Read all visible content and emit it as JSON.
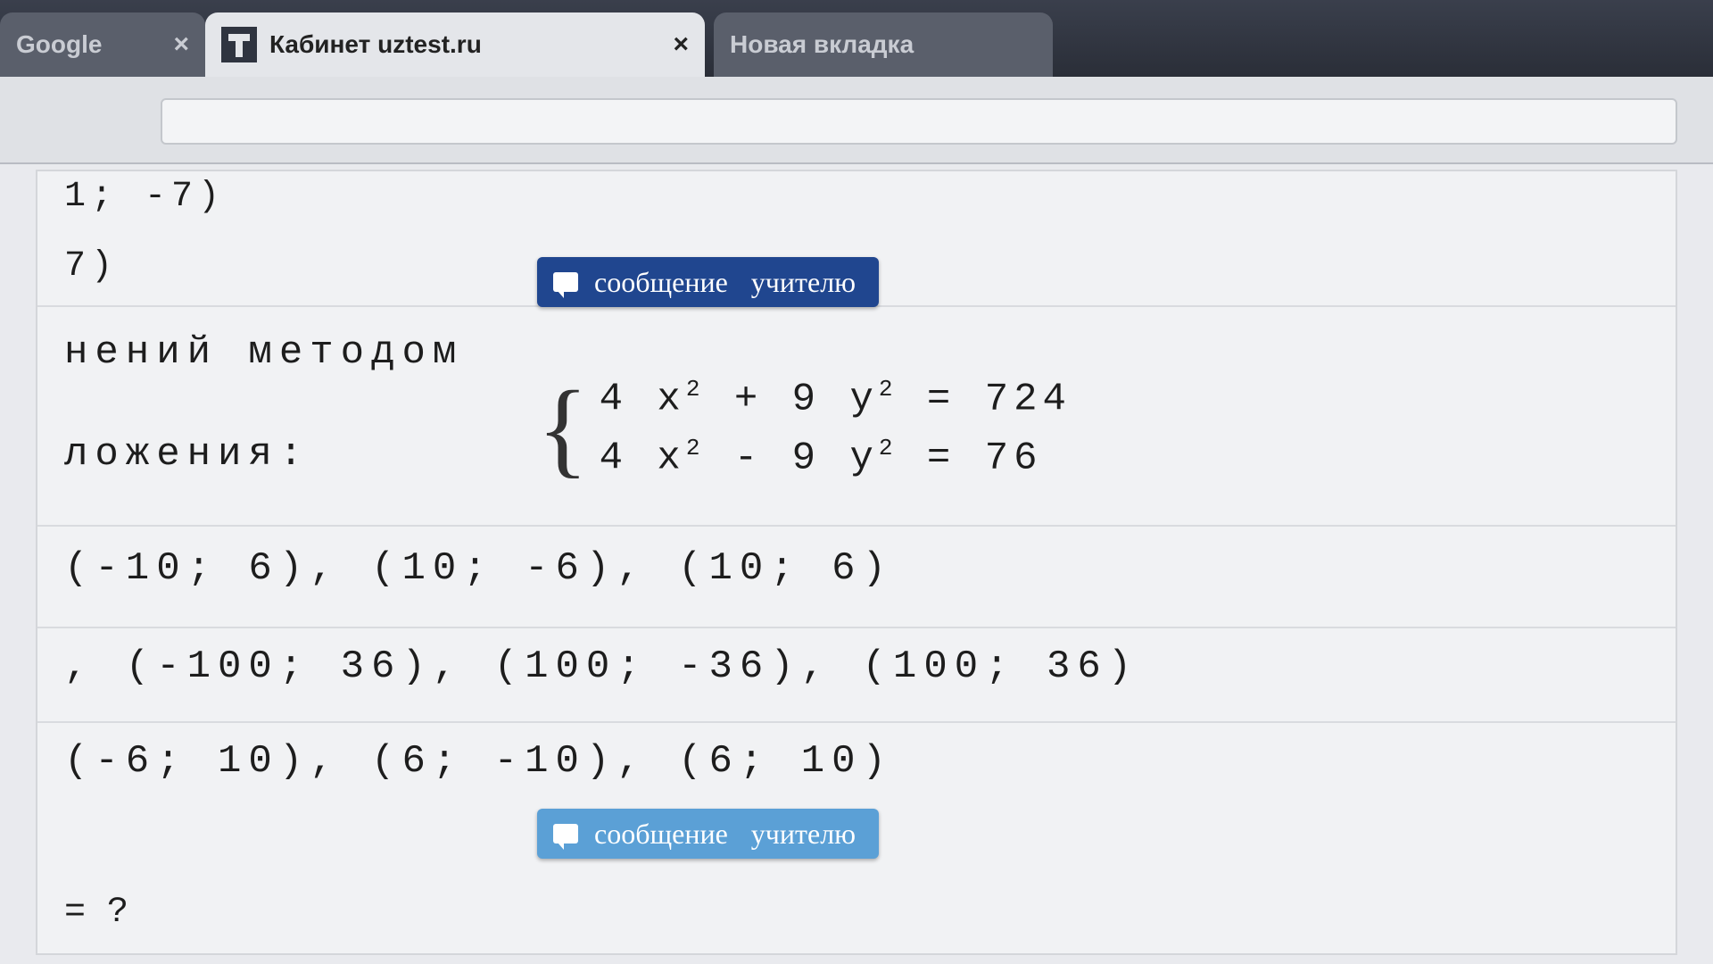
{
  "browser": {
    "tabs": [
      {
        "title": "Google",
        "close": "×"
      },
      {
        "title": "Кабинет uztest.ru",
        "close": "×"
      },
      {
        "title": "Новая вкладка"
      }
    ]
  },
  "page": {
    "prev_lines": [
      "1; -7)",
      "7)"
    ],
    "heading_line1": "нений методом",
    "heading_line2": "ложения:",
    "teacher_button": {
      "word1": "сообщение",
      "word2": "учителю"
    },
    "system": {
      "eq1": {
        "a": "4 x",
        "b": " + 9 y",
        "c": " = 724"
      },
      "eq2": {
        "a": "4 x",
        "b": " - 9 y",
        "c": " = 76"
      },
      "power": "2"
    },
    "options": [
      "(-10; 6), (10; -6), (10; 6)",
      ", (-100; 36), (100; -36), (100; 36)",
      "(-6; 10), (6; -10), (6; 10)"
    ],
    "prompt": "= ?"
  }
}
